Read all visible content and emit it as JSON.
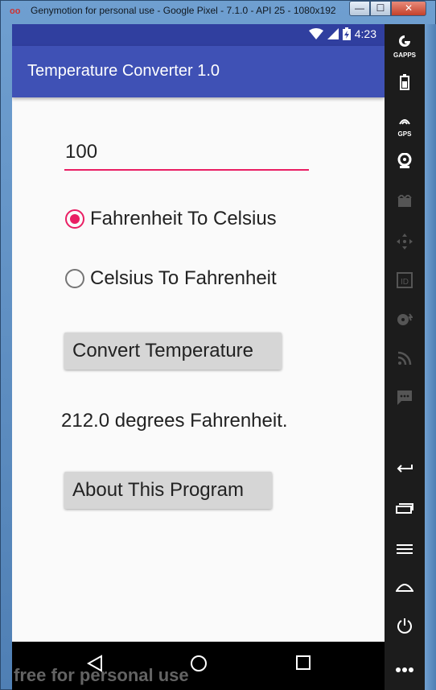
{
  "window": {
    "title": "Genymotion for personal use - Google Pixel - 7.1.0 - API 25 - 1080x192...",
    "minimize": "—",
    "maximize": "☐",
    "close": "✕"
  },
  "statusbar": {
    "time": "4:23"
  },
  "app": {
    "title": "Temperature Converter 1.0",
    "input_value": "100",
    "options": [
      {
        "label": "Fahrenheit To Celsius",
        "checked": true
      },
      {
        "label": "Celsius To Fahrenheit",
        "checked": false
      }
    ],
    "convert_button": "Convert Temperature",
    "result": "212.0 degrees Fahrenheit.",
    "about_button": "About This Program"
  },
  "watermark": "free for personal use",
  "sidebar": {
    "tools": [
      {
        "icon": "gapps-icon",
        "label": "GAPPS"
      },
      {
        "icon": "battery-icon",
        "label": ""
      },
      {
        "icon": "gps-icon",
        "label": "GPS"
      },
      {
        "icon": "webcam-icon",
        "label": ""
      },
      {
        "icon": "screencast-icon",
        "label": ""
      },
      {
        "icon": "move-icon",
        "label": ""
      },
      {
        "icon": "id-icon",
        "label": ""
      },
      {
        "icon": "disk-icon",
        "label": ""
      },
      {
        "icon": "network-icon",
        "label": ""
      },
      {
        "icon": "sms-icon",
        "label": ""
      },
      {
        "icon": "back-icon",
        "label": ""
      },
      {
        "icon": "recent-apps-icon",
        "label": ""
      },
      {
        "icon": "menu-icon",
        "label": ""
      },
      {
        "icon": "home-icon",
        "label": ""
      },
      {
        "icon": "power-icon",
        "label": ""
      },
      {
        "icon": "more-icon",
        "label": ""
      }
    ]
  },
  "colors": {
    "appbar": "#3f51b5",
    "statusbar": "#303f9f",
    "accent": "#e91e63"
  }
}
